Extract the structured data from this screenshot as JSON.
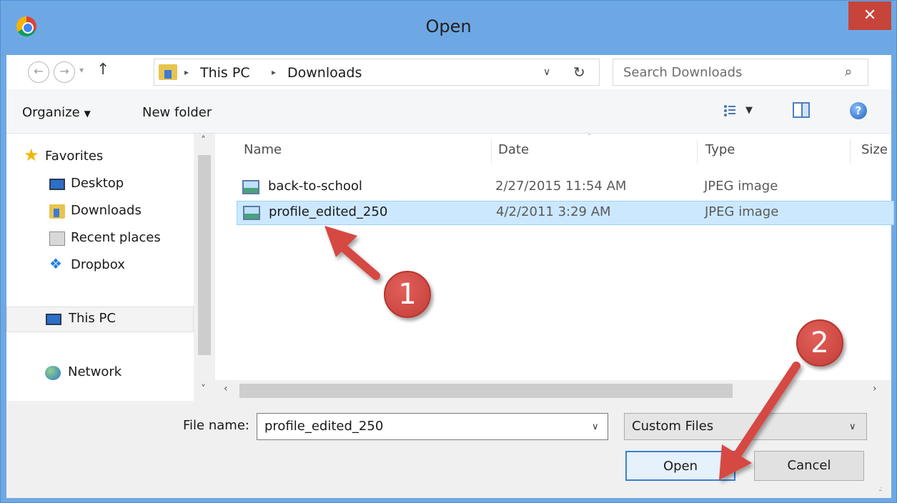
{
  "window": {
    "title": "Open",
    "close_glyph": "✕",
    "app_icon": "chrome-icon"
  },
  "navigation": {
    "back_glyph": "←",
    "forward_glyph": "→",
    "dropdown_glyph": "▾",
    "up_glyph": "↑"
  },
  "address_bar": {
    "separator": "▸",
    "crumbs": [
      "This PC",
      "Downloads"
    ],
    "dropdown_glyph": "∨",
    "refresh_glyph": "↻"
  },
  "search": {
    "placeholder": "Search Downloads",
    "icon_glyph": "⌕"
  },
  "toolbar": {
    "organize_label": "Organize",
    "caret": "▼",
    "new_folder_label": "New folder",
    "view_dropdown": "▼",
    "help_glyph": "?"
  },
  "nav_pane": {
    "items": [
      {
        "label": "Favorites",
        "icon": "star-icon"
      },
      {
        "label": "Desktop",
        "icon": "desktop-icon"
      },
      {
        "label": "Downloads",
        "icon": "downloads-folder-icon"
      },
      {
        "label": "Recent places",
        "icon": "recent-places-icon"
      },
      {
        "label": "Dropbox",
        "icon": "dropbox-icon"
      },
      {
        "label": "This PC",
        "icon": "computer-icon",
        "selected": true
      },
      {
        "label": "Network",
        "icon": "network-icon"
      }
    ],
    "scroll_up": "˄",
    "scroll_down": "˅"
  },
  "file_list": {
    "columns": [
      "Name",
      "Date",
      "Type",
      "Size"
    ],
    "sort_glyph": "ˇ",
    "rows": [
      {
        "name": "back-to-school",
        "date": "2/27/2015 11:54 AM",
        "type": "JPEG image",
        "selected": false
      },
      {
        "name": "profile_edited_250",
        "date": "4/2/2011 3:29 AM",
        "type": "JPEG image",
        "selected": true
      }
    ],
    "scroll_left": "‹",
    "scroll_right": "›"
  },
  "bottom": {
    "file_name_label": "File name:",
    "file_name_value": "profile_edited_250",
    "file_name_dropdown": "∨",
    "file_type_value": "Custom Files",
    "file_type_dropdown": "∨",
    "open_label": "Open",
    "cancel_label": "Cancel",
    "grip": "..:"
  },
  "annotations": {
    "step1": "1",
    "step2": "2",
    "color": "#d54a43"
  }
}
